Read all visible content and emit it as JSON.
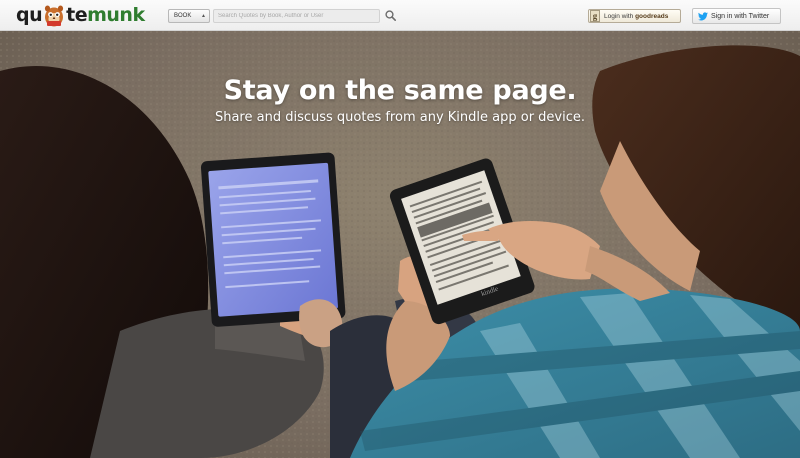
{
  "header": {
    "logo": {
      "part_a": "qu",
      "part_b_dark": "te",
      "part_b_green": "munk",
      "mascot_icon": "chipmunk-mascot-icon"
    },
    "search": {
      "type_selected": "BOOK",
      "placeholder": "Search Quotes by Book, Author or User",
      "button_icon": "search-icon"
    },
    "goodreads_button": {
      "icon_letter": "g",
      "label_prefix": "Login with ",
      "brand": "goodreads"
    },
    "twitter_button": {
      "icon": "twitter-bird-icon",
      "label": "Sign in with Twitter"
    }
  },
  "hero": {
    "headline": "Stay on the same page.",
    "subline": "Share and discuss quotes from any Kindle app or device.",
    "kindle_brand": "kindle"
  },
  "colors": {
    "logo_green": "#2f7d2f",
    "twitter_blue": "#1da1f2",
    "hero_text": "#ffffff"
  }
}
